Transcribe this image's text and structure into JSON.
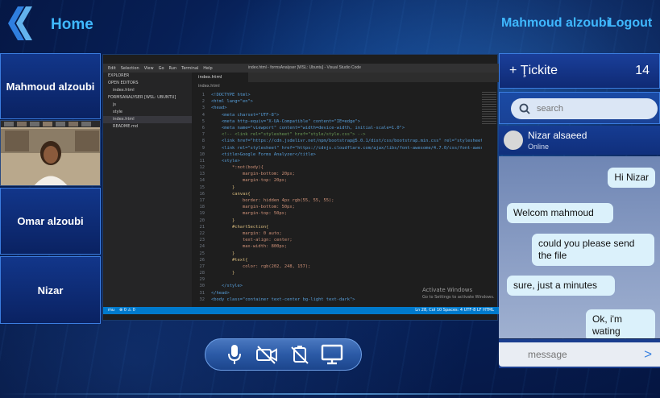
{
  "header": {
    "title": "Home",
    "user_name": "Mahmoud alzoubi",
    "logout_label": "Logout"
  },
  "participants": [
    {
      "name": "Mahmoud alzoubi"
    },
    {
      "name": "Omar alzoubi"
    },
    {
      "name": "Nizar"
    }
  ],
  "shared_screen": {
    "window_title": "index.html - formsAnalyser [WSL: Ubuntu] - Visual Studio Code",
    "menu": [
      "Edit",
      "Selection",
      "View",
      "Go",
      "Run",
      "Terminal",
      "Help"
    ],
    "explorer": [
      "EXPLORER",
      "OPEN EDITORS",
      "index.html",
      "FORMSANALYSER [WSL: UBUNTU]",
      "js",
      "style",
      "index.html",
      "README.md"
    ],
    "tab_label": "index.html",
    "breadcrumb": "index.html",
    "code_lines": [
      {
        "n": "1",
        "t": "<!DOCTYPE html>"
      },
      {
        "n": "2",
        "t": "<html lang=\"en\">"
      },
      {
        "n": "3",
        "t": "<head>"
      },
      {
        "n": "4",
        "t": "    <meta charset=\"UTF-8\">"
      },
      {
        "n": "5",
        "t": "    <meta http-equiv=\"X-UA-Compatible\" content=\"IE=edge\">"
      },
      {
        "n": "6",
        "t": "    <meta name=\"viewport\" content=\"width=device-width, initial-scale=1.0\">"
      },
      {
        "n": "7",
        "t": "    <!-- <link rel=\"stylesheet\" href=\"style/style.css\"> -->"
      },
      {
        "n": "8",
        "t": "    <link href=\"https://cdn.jsdelivr.net/npm/bootstrap@5.0.1/dist/css/bootstrap.min.css\" rel=\"stylesheet\" i"
      },
      {
        "n": "9",
        "t": "    <link rel=\"stylesheet\" href=\"https://cdnjs.cloudflare.com/ajax/libs/font-awesome/4.7.0/css/font-awesome"
      },
      {
        "n": "10",
        "t": "    <title>Google Forms Analyzer</title>"
      },
      {
        "n": "11",
        "t": "    <style>"
      },
      {
        "n": "12",
        "t": "        *:not(body){"
      },
      {
        "n": "13",
        "t": "            margin-bottom: 20px;"
      },
      {
        "n": "14",
        "t": "            margin-top: 20px;"
      },
      {
        "n": "15",
        "t": "        }"
      },
      {
        "n": "16",
        "t": "        canvas{"
      },
      {
        "n": "17",
        "t": "            border: hidden 4px rgb(55, 55, 55);"
      },
      {
        "n": "18",
        "t": "            margin-bottom: 50px;"
      },
      {
        "n": "19",
        "t": "            margin-top: 50px;"
      },
      {
        "n": "20",
        "t": "        }"
      },
      {
        "n": "21",
        "t": "        #chartSection{"
      },
      {
        "n": "22",
        "t": "            margin: 0 auto;"
      },
      {
        "n": "23",
        "t": "            text-align: center;"
      },
      {
        "n": "24",
        "t": "            max-width: 800px;"
      },
      {
        "n": "25",
        "t": "        }"
      },
      {
        "n": "26",
        "t": "        #text{"
      },
      {
        "n": "27",
        "t": "            color: rgb(202, 248, 157);"
      },
      {
        "n": "28",
        "t": "        }"
      },
      {
        "n": "29",
        "t": ""
      },
      {
        "n": "30",
        "t": "    </style>"
      },
      {
        "n": "31",
        "t": "</head>"
      },
      {
        "n": "32",
        "t": "<body class=\"container text-center bg-light text-dark\">"
      }
    ],
    "activate_title": "Activate Windows",
    "activate_sub": "Go to Settings to activate Windows.",
    "status_left": "mu",
    "status_left2": "⊗ 0 ⚠ 0",
    "status_right": "Ln 28, Col 10   Spaces: 4   UTF-8   LF   HTML"
  },
  "chat": {
    "ticket_label": "+ Ţickite",
    "ticket_count": "14",
    "search_placeholder": "search",
    "contact_name": "Nizar alsaeed",
    "contact_status": "Online",
    "messages": [
      {
        "side": "right",
        "text": "Hi Nizar"
      },
      {
        "side": "left",
        "text": "Welcom mahmoud"
      },
      {
        "side": "right",
        "text": "could you please send the file"
      },
      {
        "side": "left",
        "text": "sure, just a minutes"
      },
      {
        "side": "right",
        "text": "Ok, i'm wating"
      }
    ],
    "message_placeholder": "message"
  },
  "controls": [
    "microphone-icon",
    "camera-off-icon",
    "screen-share-off-icon",
    "monitor-icon"
  ],
  "colors": {
    "accent": "#3fb8ff",
    "bubble": "#dbf1fb",
    "vscode_status": "#007acc"
  }
}
